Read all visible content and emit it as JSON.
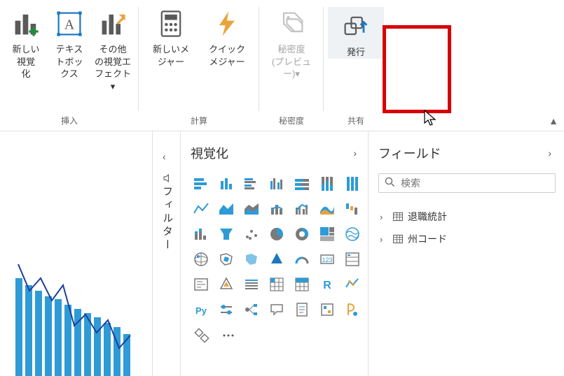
{
  "ribbon": {
    "groups": [
      {
        "name": "insert",
        "label": "挿入",
        "buttons": [
          {
            "id": "new-visual",
            "label": "新しい\n視覚\n化"
          },
          {
            "id": "text-box",
            "label": "テキス\nトボッ\nクス"
          },
          {
            "id": "more-visuals",
            "label": "その他\nの視覚エ\nフェクト",
            "dropdown": true
          }
        ]
      },
      {
        "name": "calc",
        "label": "計算",
        "buttons": [
          {
            "id": "new-measure",
            "label": "新しいメ\nジャー"
          },
          {
            "id": "quick-measure",
            "label": "クイック\nメジャー"
          }
        ]
      },
      {
        "name": "sensitivity",
        "label": "秘密度",
        "buttons": [
          {
            "id": "sensitivity",
            "label": "秘密度\n(プレビュー)",
            "dim": true,
            "dropdown": true
          }
        ]
      },
      {
        "name": "share",
        "label": "共有",
        "buttons": [
          {
            "id": "publish",
            "label": "発行"
          }
        ]
      }
    ]
  },
  "filter_pane": {
    "label": "フィルター"
  },
  "viz_pane": {
    "title": "視覚化",
    "items": [
      "stacked-bar",
      "stacked-column",
      "clustered-bar",
      "clustered-column",
      "100-stacked-bar",
      "100-stacked-column",
      "hundred-bar",
      "line",
      "area",
      "stacked-area",
      "line-stacked-column",
      "line-clustered-column",
      "ribbon",
      "waterfall",
      "scatter",
      "funnel",
      "scatter-dot",
      "pie",
      "donut",
      "treemap",
      "map",
      "filled-map",
      "shape-map",
      "azure-map",
      "arcgis",
      "gauge",
      "card",
      "multi-row-card",
      "kpi",
      "slicer",
      "table",
      "matrix",
      "r-visual",
      "python-visual",
      "key-influencers",
      "py",
      "decomposition",
      "qna",
      "chat",
      "paginated",
      "power-automate",
      "smart-narrative"
    ]
  },
  "fields_pane": {
    "title": "フィールド",
    "search_placeholder": "検索",
    "tables": [
      {
        "name": "退職統計"
      },
      {
        "name": "州コード"
      }
    ]
  }
}
